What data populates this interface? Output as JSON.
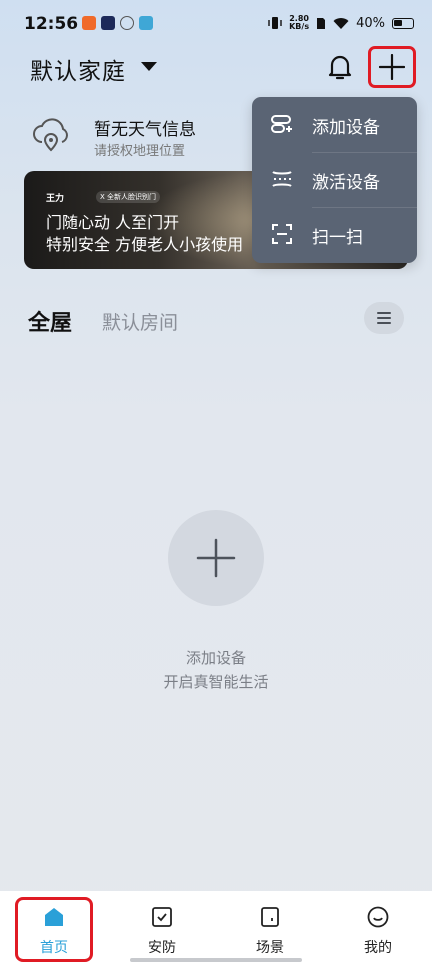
{
  "status_bar": {
    "time": "12:56",
    "net_speed_value": "2.80",
    "net_speed_unit": "KB/s",
    "battery": "40%"
  },
  "header": {
    "family_name": "默认家庭"
  },
  "weather": {
    "title": "暂无天气信息",
    "subtitle": "请授权地理位置"
  },
  "banner": {
    "brand": "王力",
    "tag": "X 全新人脸识别门",
    "line1": "门随心动 人至门开",
    "line2": "特别安全 方便老人小孩使用"
  },
  "menu": {
    "items": [
      {
        "label": "添加设备",
        "icon": "add-device-icon"
      },
      {
        "label": "激活设备",
        "icon": "activate-device-icon"
      },
      {
        "label": "扫一扫",
        "icon": "scan-icon"
      }
    ]
  },
  "rooms": {
    "all_label": "全屋",
    "default_room": "默认房间"
  },
  "empty_state": {
    "line1": "添加设备",
    "line2": "开启真智能生活"
  },
  "bottom_nav": {
    "items": [
      {
        "label": "首页",
        "icon": "home-icon",
        "active": true
      },
      {
        "label": "安防",
        "icon": "security-icon",
        "active": false
      },
      {
        "label": "场景",
        "icon": "scene-icon",
        "active": false
      },
      {
        "label": "我的",
        "icon": "profile-icon",
        "active": false
      }
    ]
  },
  "colors": {
    "accent": "#2aa0d8",
    "menu_bg": "#5a6474",
    "highlight": "#e01b24"
  }
}
